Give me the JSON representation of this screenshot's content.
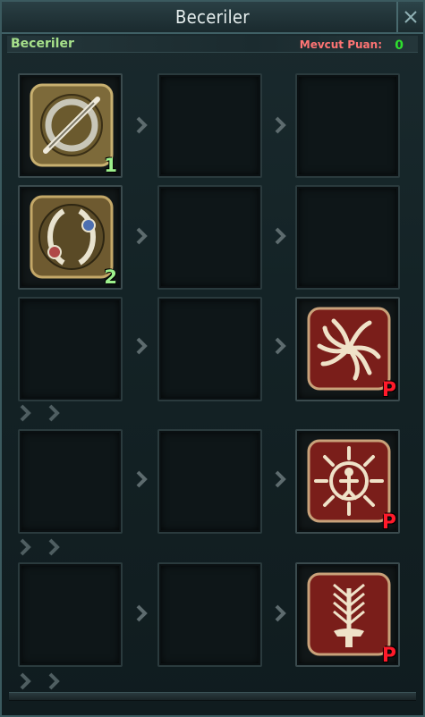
{
  "window": {
    "title": "Beceriler"
  },
  "header": {
    "subtitle": "Beceriler",
    "points_label": "Mevcut Puan:",
    "points_value": "0"
  },
  "skills": [
    {
      "row": 1,
      "col": 1,
      "icon": "slash-medallion-icon",
      "badge": "1",
      "badge_type": "level"
    },
    {
      "row": 2,
      "col": 1,
      "icon": "twin-orbs-medallion-icon",
      "badge": "2",
      "badge_type": "level"
    },
    {
      "row": 3,
      "col": 3,
      "icon": "whirlwind-blades-icon",
      "badge": "P",
      "badge_type": "passive"
    },
    {
      "row": 4,
      "col": 3,
      "icon": "radiant-figure-icon",
      "badge": "P",
      "badge_type": "passive"
    },
    {
      "row": 5,
      "col": 3,
      "icon": "sword-feathers-icon",
      "badge": "P",
      "badge_type": "passive"
    }
  ],
  "colors": {
    "level_badge": "#9df08c",
    "passive_badge": "#ff1a2a",
    "points_label": "#ff7474",
    "points_value": "#2ee02e",
    "subtitle": "#a6e08a"
  }
}
